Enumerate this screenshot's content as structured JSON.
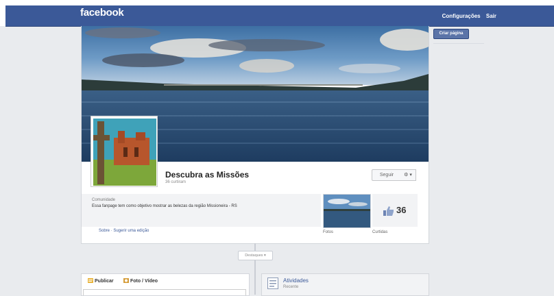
{
  "topbar": {
    "logo": "facebook",
    "links": [
      "Configurações",
      "Sair"
    ]
  },
  "page": {
    "name": "Descubra as Missões",
    "likes_line": "36 curtiram",
    "follow_button": "Seguir",
    "gear_label": "⚙ ▾",
    "category": "Comunidade",
    "description": "Essa fanpage tem como objetivo mostrar as belezas da região Missioneira - RS",
    "links": "Sobre · Sugerir uma edição",
    "likes_count": "36",
    "photos_label": "Fotos",
    "likes_label": "Curtidas"
  },
  "sidebar": {
    "create_page_button": "Criar página"
  },
  "timeline": {
    "highlights_dropdown": "Destaques ▾"
  },
  "composer": {
    "tab_post": "Publicar",
    "tab_photo": "Foto / Vídeo"
  },
  "activity": {
    "title": "Atividades",
    "subtitle": "Recente"
  },
  "colors": {
    "brand_blue": "#3b5998",
    "page_bg": "#e9ebee"
  }
}
